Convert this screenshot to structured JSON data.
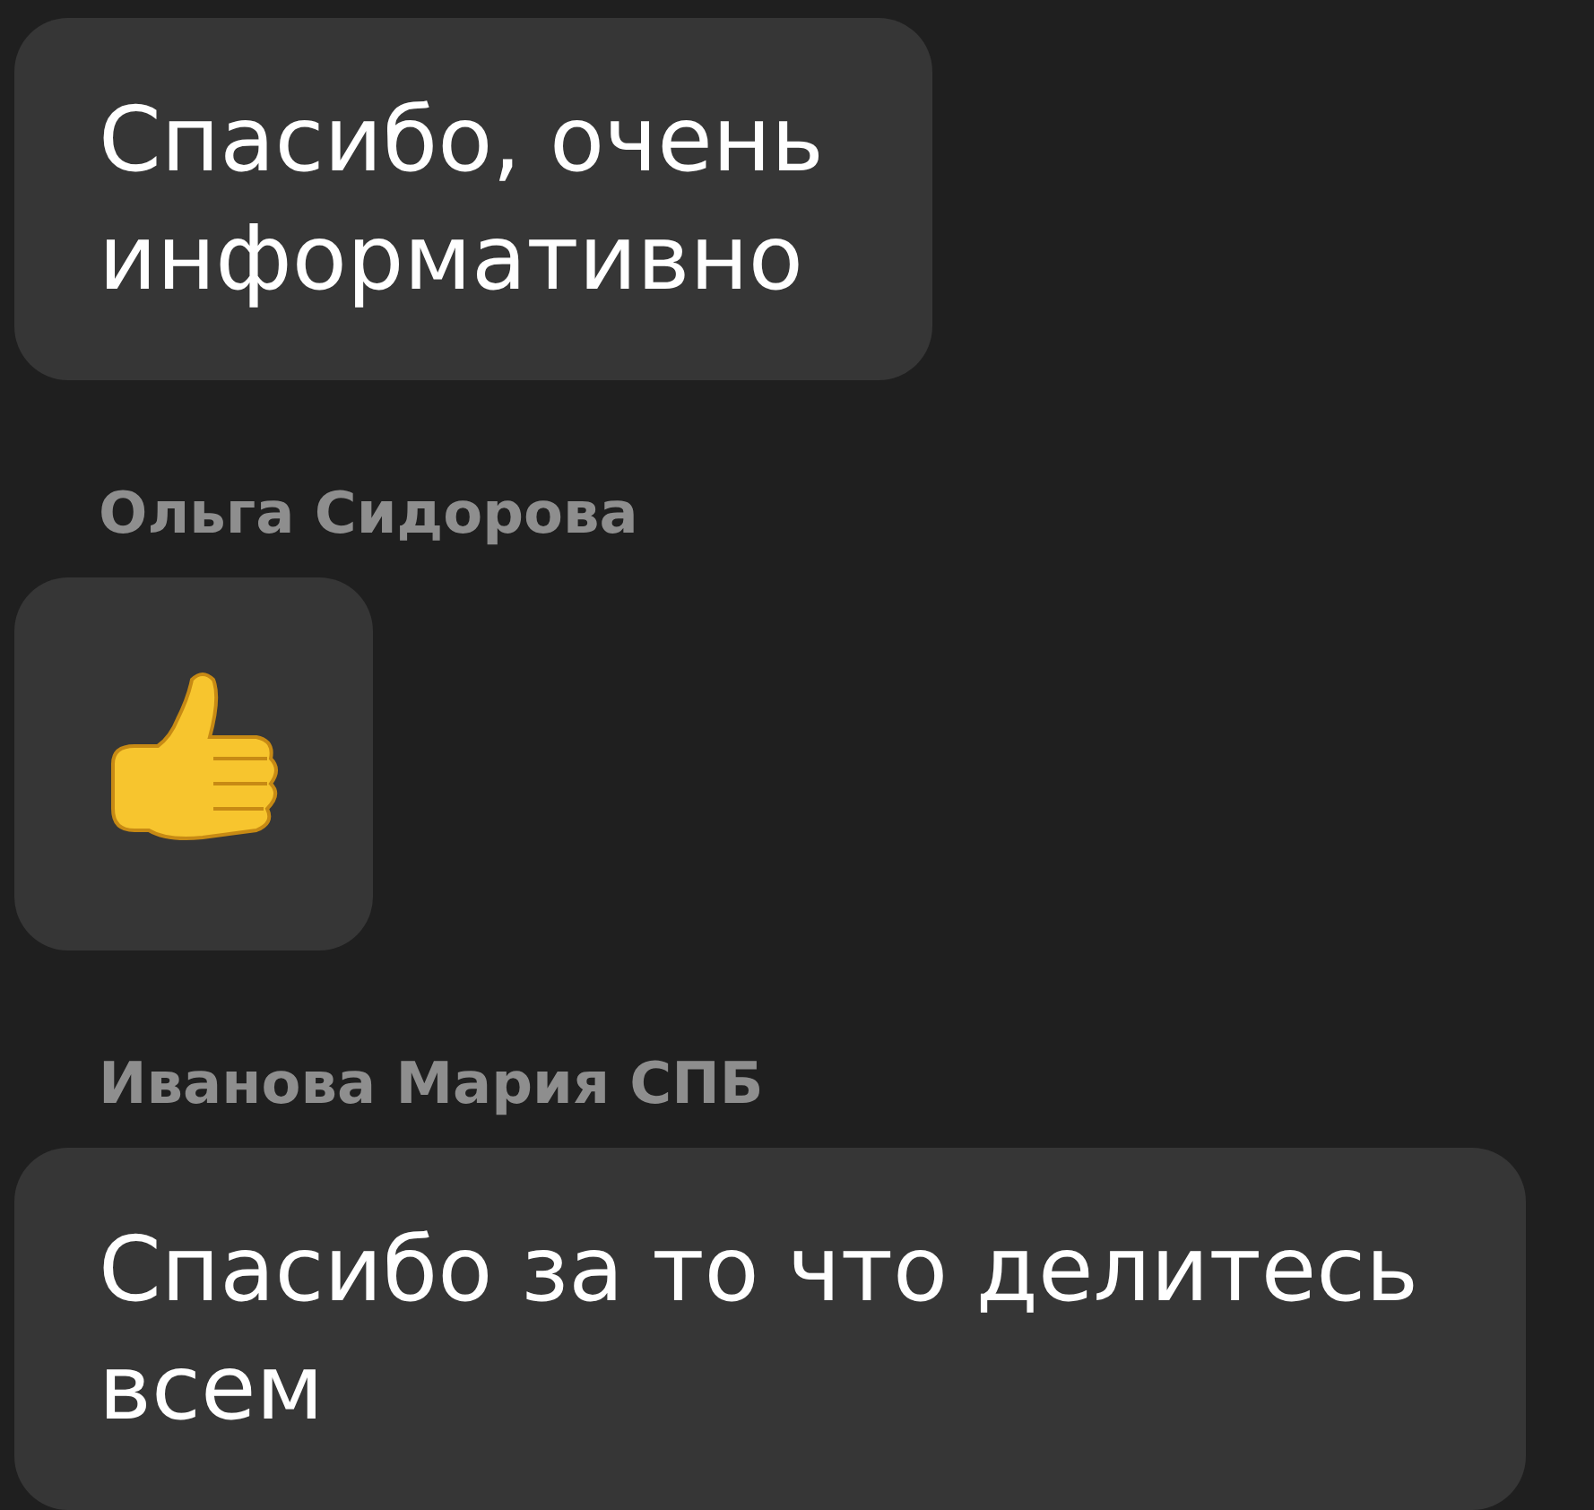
{
  "messages": [
    {
      "kind": "text",
      "text": "Спасибо, очень\nинформативно"
    },
    {
      "kind": "thumbs_up",
      "sender": "Ольга Сидорова"
    },
    {
      "kind": "text",
      "sender": "Иванова Мария СПБ",
      "text": "Спасибо за то что делитесь\nвсем"
    }
  ]
}
